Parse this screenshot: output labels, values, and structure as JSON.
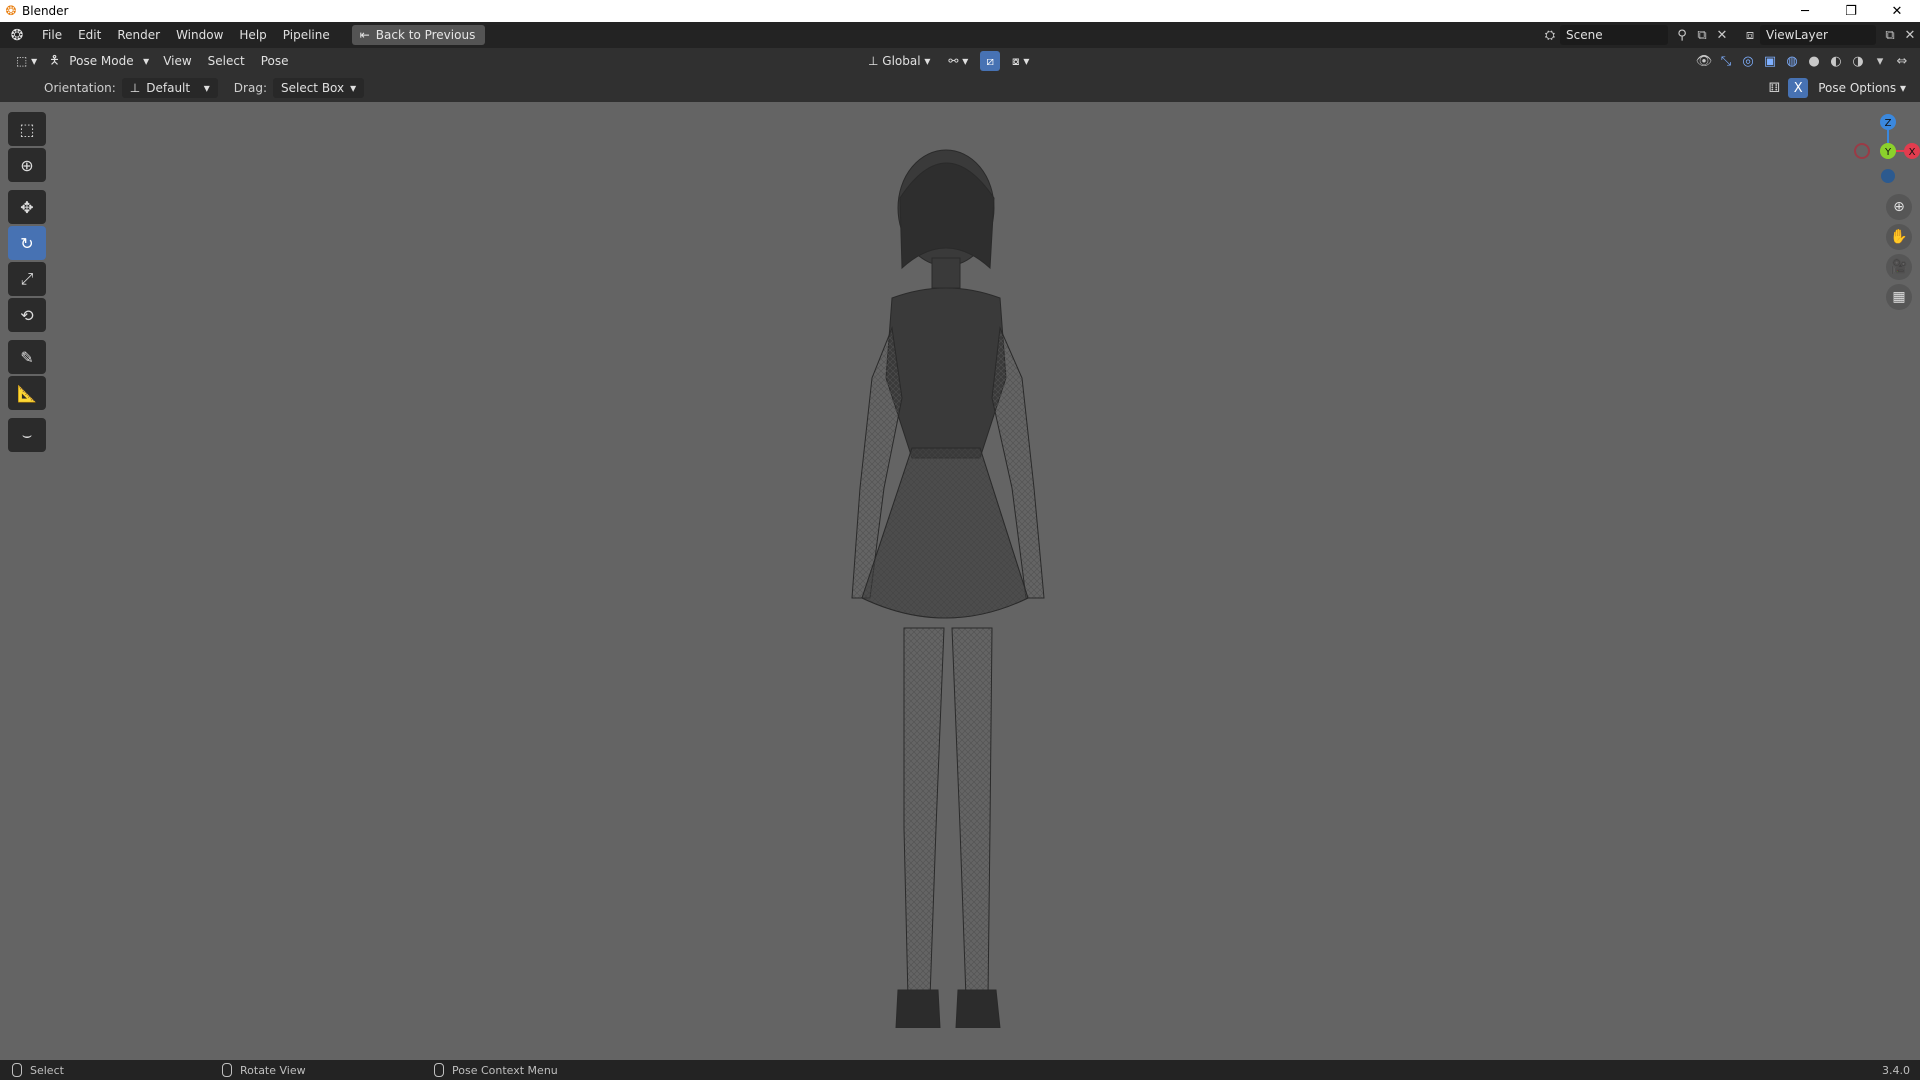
{
  "window": {
    "title": "Blender",
    "icons": [
      "blender-icon",
      "minimize-icon",
      "restore-icon",
      "close-icon"
    ]
  },
  "menu": [
    "File",
    "Edit",
    "Render",
    "Window",
    "Help",
    "Pipeline"
  ],
  "back_button": "Back to Previous",
  "scene": {
    "name": "Scene"
  },
  "view_layer": {
    "name": "ViewLayer"
  },
  "header": {
    "mode": "Pose Mode",
    "menus": [
      "View",
      "Select",
      "Pose"
    ],
    "transform_orientation": "Global"
  },
  "tool_settings": {
    "orientation_label": "Orientation:",
    "orientation_value": "Default",
    "drag_label": "Drag:",
    "drag_value": "Select Box",
    "pose_options": "Pose Options"
  },
  "gizmo": {
    "z": "Z",
    "y": "Y",
    "x": "X"
  },
  "status": {
    "left": "Select",
    "middle": "Rotate View",
    "right": "Pose Context Menu",
    "version": "3.4.0"
  },
  "colors": {
    "accent": "#4772b3",
    "viewport_bg": "#646464",
    "axis_x": "#e23c4e",
    "axis_y": "#8bd12b",
    "axis_z": "#3b88dd"
  }
}
